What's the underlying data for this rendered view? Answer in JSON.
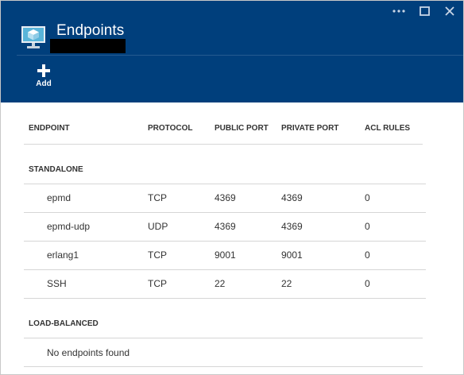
{
  "header": {
    "title": "Endpoints",
    "add_label": "Add"
  },
  "table": {
    "columns": [
      "ENDPOINT",
      "PROTOCOL",
      "PUBLIC PORT",
      "PRIVATE PORT",
      "ACL RULES"
    ],
    "groups": [
      {
        "label": "STANDALONE",
        "rows": [
          [
            "epmd",
            "TCP",
            "4369",
            "4369",
            "0"
          ],
          [
            "epmd-udp",
            "UDP",
            "4369",
            "4369",
            "0"
          ],
          [
            "erlang1",
            "TCP",
            "9001",
            "9001",
            "0"
          ],
          [
            "SSH",
            "TCP",
            "22",
            "22",
            "0"
          ]
        ]
      },
      {
        "label": "LOAD-BALANCED",
        "empty_text": "No endpoints found"
      }
    ]
  },
  "colors": {
    "header_bg": "#003f7c",
    "row_border": "#d6d6d6"
  }
}
